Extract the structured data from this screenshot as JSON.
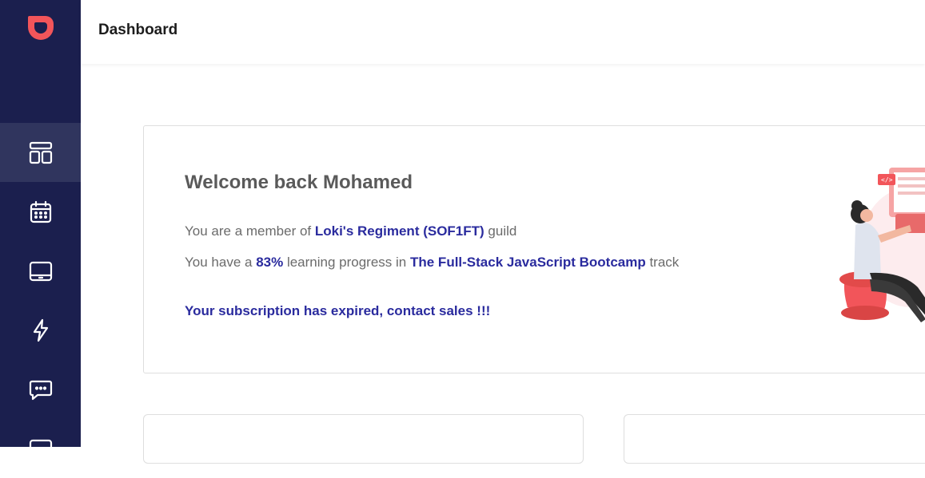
{
  "app": {
    "accent_color": "#f2555a",
    "sidebar_color": "#1b1f4e"
  },
  "header": {
    "title": "Dashboard"
  },
  "sidebar": {
    "items": [
      {
        "icon": "layout-icon",
        "active": true
      },
      {
        "icon": "calendar-icon",
        "active": false
      },
      {
        "icon": "tablet-icon",
        "active": false
      },
      {
        "icon": "lightning-icon",
        "active": false
      },
      {
        "icon": "chat-icon",
        "active": false
      },
      {
        "icon": "monitor-icon",
        "active": false
      }
    ]
  },
  "welcome": {
    "heading": "Welcome back Mohamed",
    "guild_prefix": "You are a member of ",
    "guild_name": "Loki's Regiment (SOF1FT)",
    "guild_suffix": " guild",
    "progress_prefix": "You have a ",
    "progress_value": "83%",
    "progress_middle": " learning progress in ",
    "track_name": "The Full-Stack JavaScript Bootcamp",
    "track_suffix": " track",
    "subscription_notice": "Your subscription has expired, contact sales !!!"
  }
}
